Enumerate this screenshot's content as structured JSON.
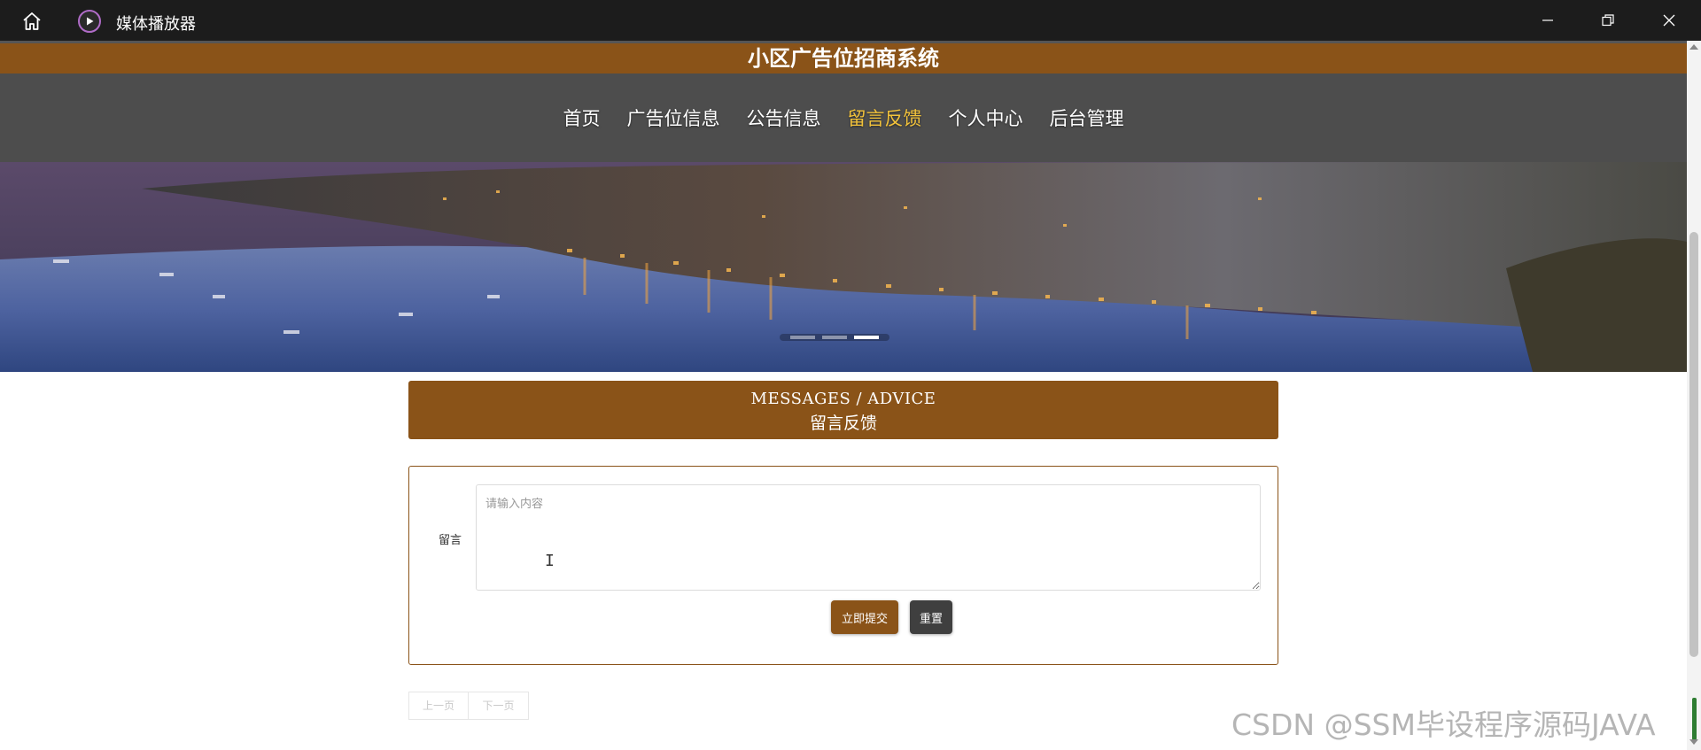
{
  "window": {
    "app_title": "媒体播放器",
    "icons": {
      "home": "home-icon",
      "app": "play-circle-icon",
      "minimize": "minimize-icon",
      "maximize": "restore-icon",
      "close": "close-icon"
    }
  },
  "site": {
    "title": "小区广告位招商系统",
    "nav": [
      {
        "label": "首页",
        "active": false
      },
      {
        "label": "广告位信息",
        "active": false
      },
      {
        "label": "公告信息",
        "active": false
      },
      {
        "label": "留言反馈",
        "active": true
      },
      {
        "label": "个人中心",
        "active": false
      },
      {
        "label": "后台管理",
        "active": false
      }
    ],
    "banner": {
      "slides": 3,
      "active_slide": 2
    }
  },
  "section": {
    "title_en": "MESSAGES / ADVICE",
    "title_cn": "留言反馈"
  },
  "form": {
    "label": "留言",
    "placeholder": "请输入内容",
    "value": "",
    "submit": "立即提交",
    "reset": "重置"
  },
  "pager": {
    "prev": "上一页",
    "next": "下一页"
  },
  "watermark": "CSDN @SSM毕设程序源码JAVA",
  "colors": {
    "brand": "#8a5318",
    "nav_bg": "#4d4d4d",
    "nav_active": "#f2c23a",
    "reset_btn": "#3f3f3f"
  }
}
